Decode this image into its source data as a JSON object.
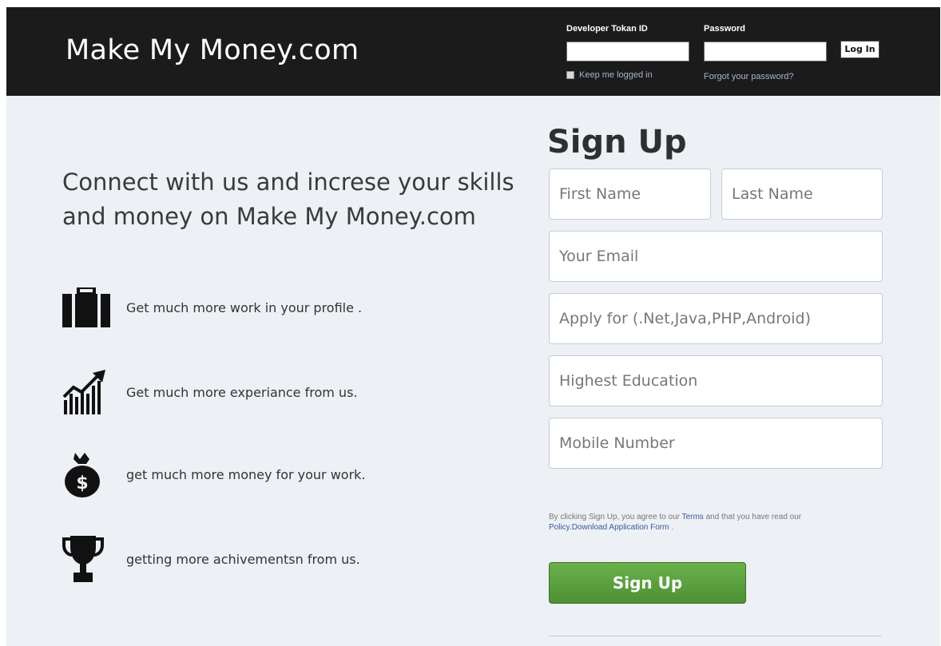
{
  "header": {
    "logo": "Make My Money.com",
    "token_label": "Developer Tokan ID",
    "password_label": "Password",
    "login_button": "Log In",
    "keep_logged_in": "Keep me logged in",
    "forgot_password": "Forgot your password?"
  },
  "main": {
    "tagline": "Connect with us and increse your skills and money on Make My Money.com",
    "features": [
      {
        "icon": "briefcase-icon",
        "text": "Get much more work in your profile ."
      },
      {
        "icon": "growth-chart-icon",
        "text": "Get much more experiance from us."
      },
      {
        "icon": "money-bag-icon",
        "text": "get much more money for your work."
      },
      {
        "icon": "trophy-icon",
        "text": "getting more achivementsn from us."
      }
    ]
  },
  "signup": {
    "title": "Sign Up",
    "first_name_placeholder": "First Name",
    "last_name_placeholder": "Last Name",
    "email_placeholder": "Your Email",
    "apply_placeholder": "Apply for (.Net,Java,PHP,Android)",
    "education_placeholder": "Highest Education",
    "mobile_placeholder": "Mobile Number",
    "terms_pre": "By clicking Sign Up, you agree to our ",
    "terms_link": "Terms",
    "terms_mid": " and that you have read our ",
    "policy_link": "Policy.Download Application Form",
    "terms_end": " .",
    "button": "Sign Up"
  },
  "colors": {
    "header_bg": "#1b1b1b",
    "page_bg": "#edf0f5",
    "button_green": "#5aa03e",
    "link": "#3b5998"
  }
}
